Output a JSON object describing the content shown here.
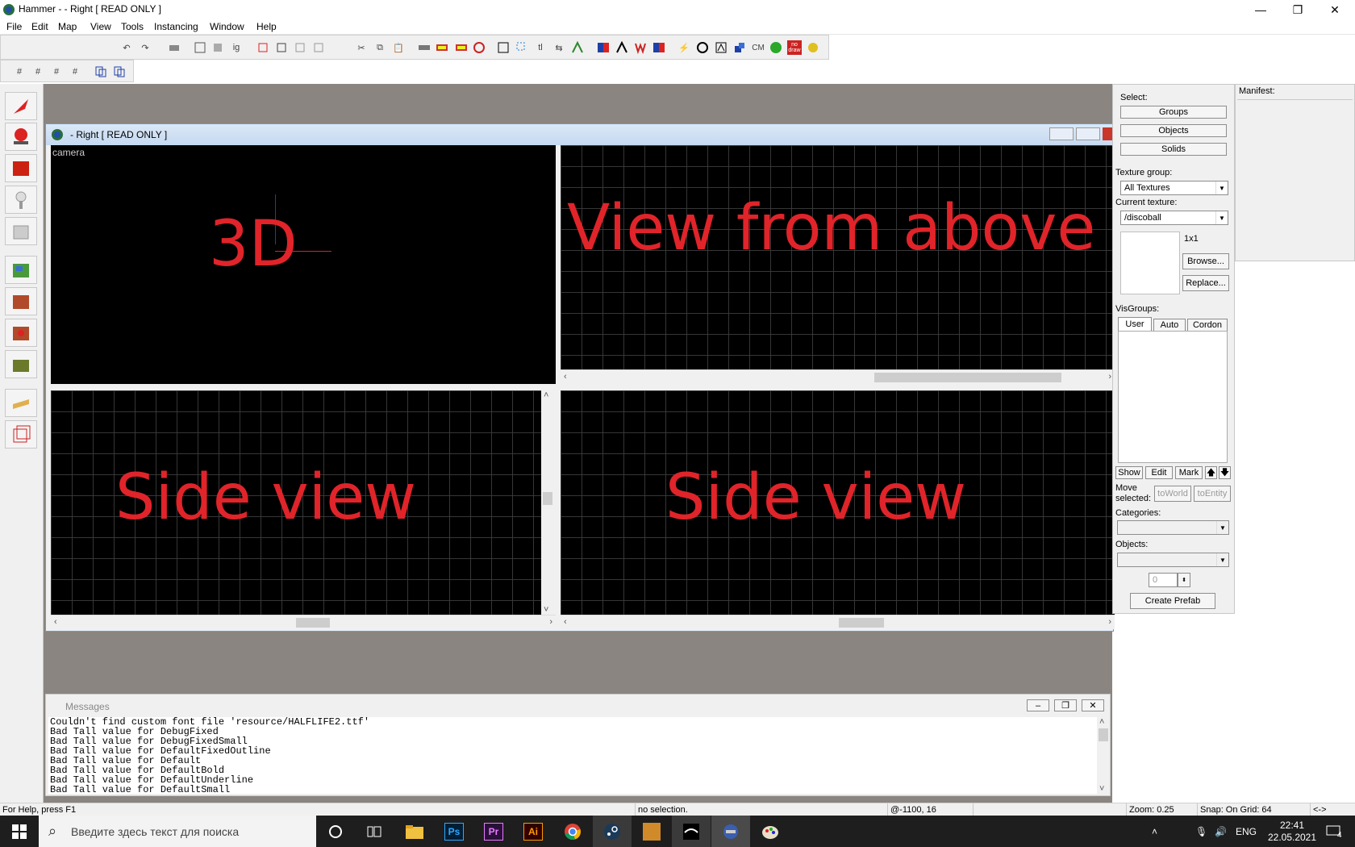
{
  "window": {
    "title": "Hammer -  - Right [ READ ONLY ]",
    "minimize": "—",
    "restore": "❐",
    "close": "✕"
  },
  "menu": [
    "File",
    "Edit",
    "Map",
    "View",
    "Tools",
    "Instancing",
    "Window",
    "Help"
  ],
  "toolbar": {
    "cm_label": "CM",
    "nodraw_label": "no draw"
  },
  "mapwindow": {
    "title": "- Right [ READ ONLY ]"
  },
  "viewports": {
    "camera_label": "camera",
    "v3d": "3D",
    "top": "View from above",
    "side1": "Side view",
    "side2": "Side view"
  },
  "rightpanel": {
    "select_label": "Select:",
    "groups": "Groups",
    "objects": "Objects",
    "solids": "Solids",
    "texture_group_label": "Texture group:",
    "texture_group_value": "All Textures",
    "current_texture_label": "Current texture:",
    "current_texture_value": "/discoball",
    "size": "1x1",
    "browse": "Browse...",
    "replace": "Replace...",
    "visgroups_label": "VisGroups:",
    "tabs": [
      "User",
      "Auto",
      "Cordon"
    ],
    "show": "Show",
    "edit": "Edit",
    "mark": "Mark",
    "move_selected": "Move selected:",
    "to_world": "toWorld",
    "to_entity": "toEntity",
    "categories_label": "Categories:",
    "objects_label": "Objects:",
    "count": "0",
    "create_prefab": "Create Prefab"
  },
  "manifest": {
    "label": "Manifest:"
  },
  "messages": {
    "title": "Messages",
    "lines": [
      "Couldn't find custom font file 'resource/HALFLIFE2.ttf'",
      "Bad Tall value for DebugFixed",
      "Bad Tall value for DebugFixedSmall",
      "Bad Tall value for DefaultFixedOutline",
      "Bad Tall value for Default",
      "Bad Tall value for DefaultBold",
      "Bad Tall value for DefaultUnderline",
      "Bad Tall value for DefaultSmall"
    ]
  },
  "status": {
    "help": "For Help, press F1",
    "selection": "no selection.",
    "coords": "@-1100, 16",
    "zoom": "Zoom: 0.25",
    "snap": "Snap: On Grid: 64",
    "arrows": "<->"
  },
  "taskbar": {
    "search_placeholder": "Введите здесь текст для поиска",
    "lang": "ENG",
    "time": "22:41",
    "date": "22.05.2021",
    "notifications": "4",
    "ps": "Ps",
    "pr": "Pr",
    "ai": "Ai"
  }
}
